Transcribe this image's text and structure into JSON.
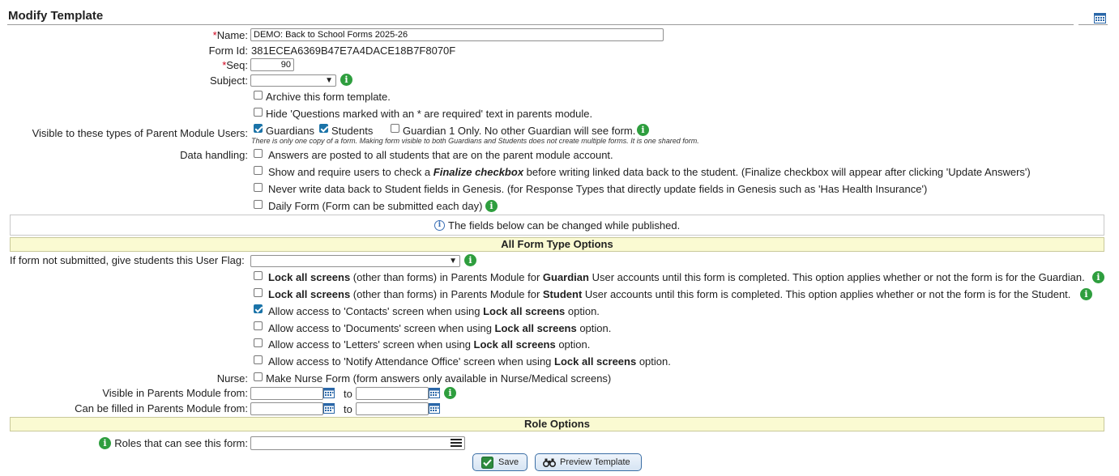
{
  "header": {
    "title": "Modify Template",
    "calendar_icon": "calendar-icon"
  },
  "fields": {
    "name_label": "Name:",
    "name_value": "DEMO: Back to School Forms 2025-26",
    "formid_label": "Form Id:",
    "formid_value": "381ECEA6369B47E7A4DACE18B7F8070F",
    "seq_label": "Seq:",
    "seq_value": "90",
    "subject_label": "Subject:",
    "subject_value": "",
    "required_marker": "*"
  },
  "options": {
    "archive": {
      "label": "Archive this form template.",
      "checked": false
    },
    "hide_required": {
      "label": "Hide 'Questions marked with an * are required' text in parents module.",
      "checked": false
    }
  },
  "visible": {
    "label": "Visible to these types of Parent Module Users:",
    "guardians": {
      "label": "Guardians",
      "checked": true
    },
    "students": {
      "label": "Students",
      "checked": true
    },
    "guardian1": {
      "label": "Guardian 1 Only. No other Guardian will see form.",
      "checked": false
    },
    "note": "There is only one copy of a form. Making form visible to both Guardians and Students does not create multiple forms. It is one shared form."
  },
  "data_handling": {
    "label": "Data handling:",
    "posted_all": "Answers are posted to all students that are on the parent module account.",
    "finalize_pre": "Show and require users to check a ",
    "finalize_bold": "Finalize checkbox",
    "finalize_post": " before writing linked data back to the student. (Finalize checkbox will appear after clicking 'Update Answers')",
    "never_write": "Never write data back to Student fields in Genesis. (for Response Types that directly update fields in Genesis such as 'Has Health Insurance')",
    "daily": "Daily Form (Form can be submitted each day)"
  },
  "published_note": "The fields below can be changed while published.",
  "all_form_section": {
    "title": "All Form Type Options",
    "user_flag_label": "If form not submitted, give students this User Flag:",
    "lock_guardian": {
      "b1": "Lock all screens",
      "t1": " (other than forms) in Parents Module for ",
      "b2": "Guardian",
      "t2": " User accounts until this form is completed. This option applies whether or not the form is for the Guardian."
    },
    "lock_student": {
      "b1": "Lock all screens",
      "t1": " (other than forms) in Parents Module for ",
      "b2": "Student",
      "t2": " User accounts until this form is completed. This option applies whether or not the form is for the Student."
    },
    "allow_contacts": {
      "t1": "Allow access to 'Contacts' screen when using ",
      "b": "Lock all screens",
      "t2": " option.",
      "checked": true
    },
    "allow_documents": {
      "t1": "Allow access to 'Documents' screen when using ",
      "b": "Lock all screens",
      "t2": " option.",
      "checked": false
    },
    "allow_letters": {
      "t1": "Allow access to 'Letters' screen when using ",
      "b": "Lock all screens",
      "t2": " option.",
      "checked": false
    },
    "allow_attendance": {
      "t1": "Allow access to 'Notify Attendance Office' screen when using ",
      "b": "Lock all screens",
      "t2": " option.",
      "checked": false
    },
    "nurse_label": "Nurse:",
    "nurse_option": "Make Nurse Form (form answers only available in Nurse/Medical screens)",
    "visible_from_label": "Visible in Parents Module from:",
    "filled_from_label": "Can be filled in Parents Module from:",
    "to_label": "to"
  },
  "role_section": {
    "title": "Role Options",
    "roles_label": "Roles that can see this form:"
  },
  "buttons": {
    "save": "Save",
    "preview": "Preview Template"
  },
  "colors": {
    "band": "#fafad2",
    "info_green": "#2e9e3e",
    "checkbox_blue": "#1a73a8",
    "required_red": "#d0021b"
  }
}
